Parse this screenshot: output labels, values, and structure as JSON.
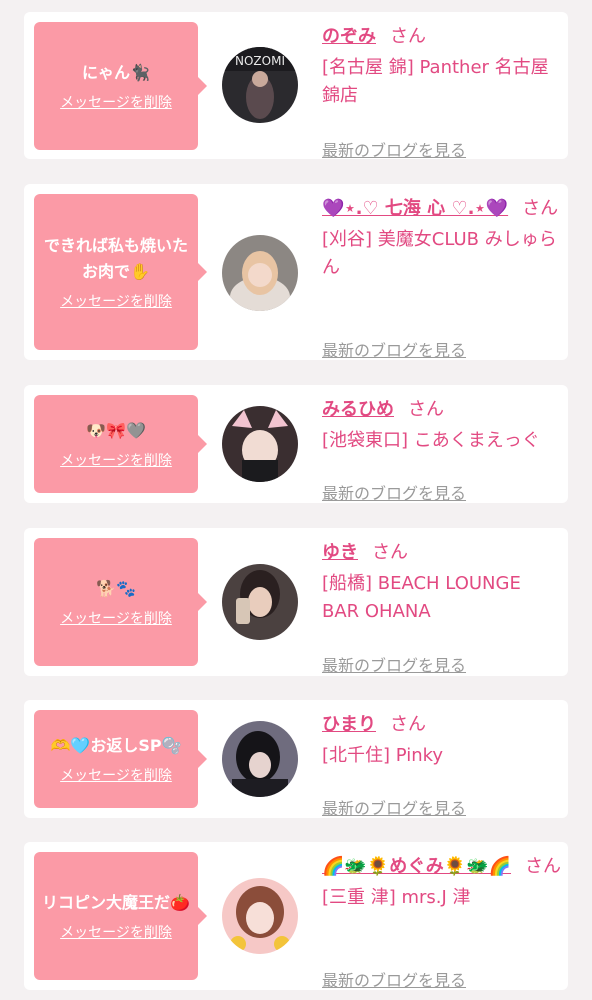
{
  "colors": {
    "bubble": "#fb9aa6",
    "accent": "#e24a82",
    "muted": "#9a9a9a",
    "background": "#f4f1f2"
  },
  "delete_label": "メッセージを削除",
  "san_label": "さん",
  "blog_label": "最新のブログを見る",
  "cards": [
    {
      "message": "にゃん🐈‍⬛",
      "name": "のぞみ",
      "shop": "[名古屋 錦] Panther 名古屋錦店",
      "avatar_text": "NOZOMI"
    },
    {
      "message": "できれば私も焼いたお肉で✋",
      "name": "💜⋆.♡ 七海 心 ♡.⋆💜",
      "shop": "[刈谷] 美魔女CLUB みしゅらん"
    },
    {
      "message": "🐶🎀🩶",
      "name": "みるひめ",
      "shop": "[池袋東口] こあくまえっぐ"
    },
    {
      "message": "🐕🐾",
      "name": "ゆき",
      "shop": "[船橋] BEACH LOUNGE BAR OHANA"
    },
    {
      "message": "🫶🩵お返しSP🫧",
      "name": "ひまり",
      "shop": "[北千住] Pinky"
    },
    {
      "message": "リコピン大魔王だ🍅",
      "name": "🌈🐲🌻めぐみ🌻🐲🌈",
      "shop": "[三重 津] mrs.J 津"
    }
  ]
}
